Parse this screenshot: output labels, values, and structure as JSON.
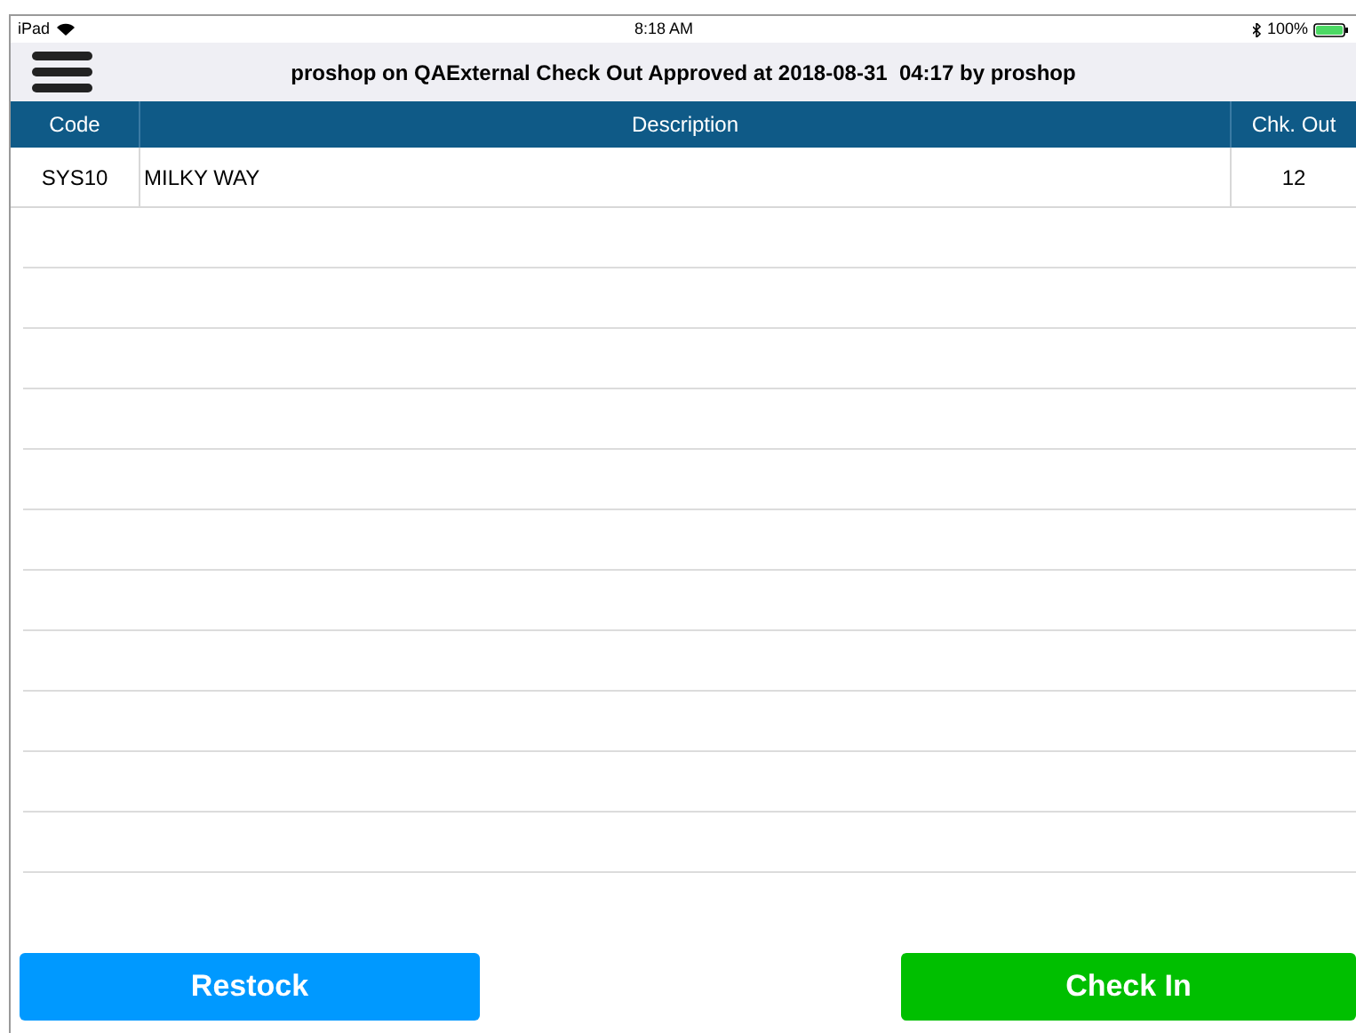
{
  "status_bar": {
    "device": "iPad",
    "time": "8:18 AM",
    "battery": "100%"
  },
  "header": {
    "title": "proshop on QAExternal Check Out Approved at 2018-08-31  04:17 by proshop"
  },
  "table": {
    "columns": [
      "Code",
      "Description",
      "Chk. Out"
    ],
    "rows": [
      {
        "cells": [
          "SYS10",
          "MILKY WAY",
          "12"
        ]
      }
    ]
  },
  "buttons": [
    {
      "label": "Restock",
      "kind": "restock"
    },
    {
      "label": "Check In",
      "kind": "checkin"
    }
  ]
}
